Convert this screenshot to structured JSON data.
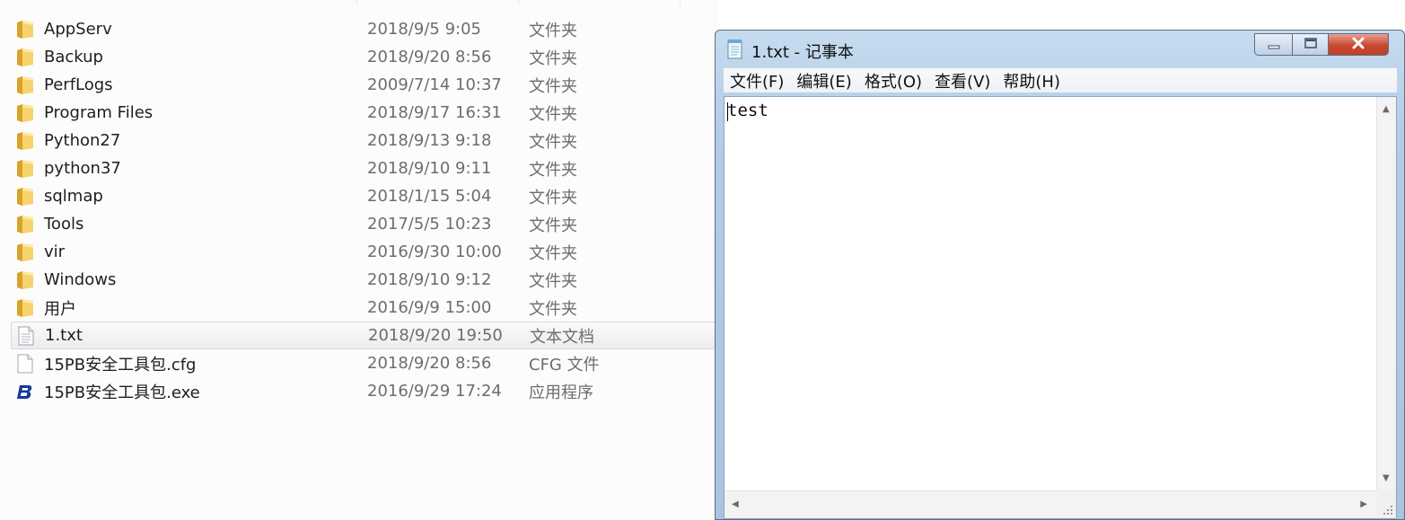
{
  "explorer": {
    "files": [
      {
        "name": "AppServ",
        "date": "2018/9/5 9:05",
        "type": "文件夹",
        "icon": "folder-icon"
      },
      {
        "name": "Backup",
        "date": "2018/9/20 8:56",
        "type": "文件夹",
        "icon": "folder-icon"
      },
      {
        "name": "PerfLogs",
        "date": "2009/7/14 10:37",
        "type": "文件夹",
        "icon": "folder-icon"
      },
      {
        "name": "Program Files",
        "date": "2018/9/17 16:31",
        "type": "文件夹",
        "icon": "folder-icon"
      },
      {
        "name": "Python27",
        "date": "2018/9/13 9:18",
        "type": "文件夹",
        "icon": "folder-icon"
      },
      {
        "name": "python37",
        "date": "2018/9/10 9:11",
        "type": "文件夹",
        "icon": "folder-icon"
      },
      {
        "name": "sqlmap",
        "date": "2018/1/15 5:04",
        "type": "文件夹",
        "icon": "folder-icon"
      },
      {
        "name": "Tools",
        "date": "2017/5/5 10:23",
        "type": "文件夹",
        "icon": "folder-icon"
      },
      {
        "name": "vir",
        "date": "2016/9/30 10:00",
        "type": "文件夹",
        "icon": "folder-icon"
      },
      {
        "name": "Windows",
        "date": "2018/9/10 9:12",
        "type": "文件夹",
        "icon": "folder-icon"
      },
      {
        "name": "用户",
        "date": "2016/9/9 15:00",
        "type": "文件夹",
        "icon": "folder-icon"
      },
      {
        "name": "1.txt",
        "date": "2018/9/20 19:50",
        "type": "文本文档",
        "icon": "text-file-icon",
        "selected": true
      },
      {
        "name": "15PB安全工具包.cfg",
        "date": "2018/9/20 8:56",
        "type": "CFG 文件",
        "icon": "file-icon"
      },
      {
        "name": "15PB安全工具包.exe",
        "date": "2016/9/29 17:24",
        "type": "应用程序",
        "icon": "app-b-icon"
      }
    ]
  },
  "notepad": {
    "title": "1.txt - 记事本",
    "menu": [
      "文件(F)",
      "编辑(E)",
      "格式(O)",
      "查看(V)",
      "帮助(H)"
    ],
    "content": "test",
    "colors": {
      "title_bg": "#b4cde6",
      "close_button": "#c9472f"
    }
  }
}
